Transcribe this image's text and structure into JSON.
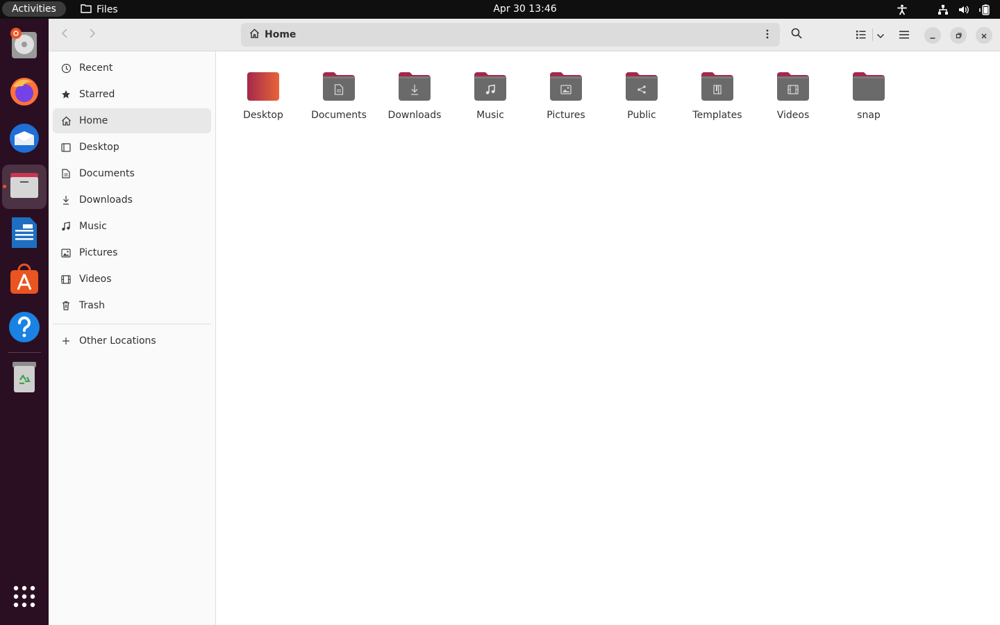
{
  "topbar": {
    "activities": "Activities",
    "app_name": "Files",
    "clock": "Apr 30  13:46"
  },
  "window": {
    "path": "Home"
  },
  "sidebar": {
    "items": [
      {
        "label": "Recent",
        "icon": "clock-icon"
      },
      {
        "label": "Starred",
        "icon": "star-icon"
      },
      {
        "label": "Home",
        "icon": "home-icon"
      },
      {
        "label": "Desktop",
        "icon": "desktop-icon"
      },
      {
        "label": "Documents",
        "icon": "document-icon"
      },
      {
        "label": "Downloads",
        "icon": "download-icon"
      },
      {
        "label": "Music",
        "icon": "music-icon"
      },
      {
        "label": "Pictures",
        "icon": "picture-icon"
      },
      {
        "label": "Videos",
        "icon": "video-icon"
      },
      {
        "label": "Trash",
        "icon": "trash-icon"
      }
    ],
    "other_locations": "Other Locations"
  },
  "folders": [
    {
      "name": "Desktop",
      "glyph": "none"
    },
    {
      "name": "Documents",
      "glyph": "document"
    },
    {
      "name": "Downloads",
      "glyph": "download"
    },
    {
      "name": "Music",
      "glyph": "music"
    },
    {
      "name": "Pictures",
      "glyph": "picture"
    },
    {
      "name": "Public",
      "glyph": "share"
    },
    {
      "name": "Templates",
      "glyph": "template"
    },
    {
      "name": "Videos",
      "glyph": "video"
    },
    {
      "name": "snap",
      "glyph": "none"
    }
  ],
  "colors": {
    "accent": "#e95420",
    "folder_tab": "#a3294a",
    "folder_body": "#6a6a6a",
    "dock_bg": "#2a0f22"
  }
}
